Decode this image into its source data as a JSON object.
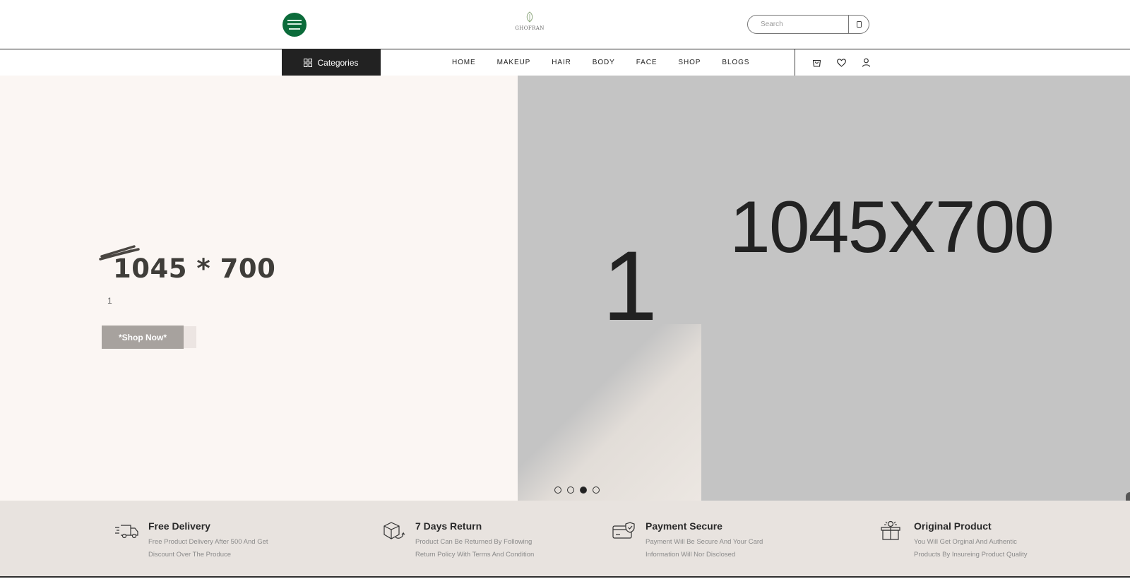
{
  "header": {
    "logo_text": "GHOFRAN",
    "search_placeholder": "Search"
  },
  "nav": {
    "categories_label": "Categories",
    "menu": [
      "HOME",
      "MAKEUP",
      "HAIR",
      "BODY",
      "FACE",
      "SHOP",
      "BLOGS"
    ],
    "icons": [
      "cart-icon",
      "heart-icon",
      "user-icon"
    ]
  },
  "hero": {
    "title": "1045 * 700",
    "subtitle": "1",
    "cta_label": "*Shop Now*",
    "placeholder_text": "1045X700",
    "placeholder_partial": "1(",
    "slides_total": 4,
    "active_slide": 3
  },
  "features": [
    {
      "icon": "delivery-truck-icon",
      "title": "Free Delivery",
      "description": "Free Product Delivery After 500 And Get Discount Over The Produce"
    },
    {
      "icon": "return-box-icon",
      "title": "7 Days Return",
      "description": "Product Can Be Returned By Following Return Policy With Terms And Condition"
    },
    {
      "icon": "secure-card-icon",
      "title": "Payment Secure",
      "description": "Payment Will Be Secure And Your Card Information Will Nor Disclosed"
    },
    {
      "icon": "original-product-icon",
      "title": "Original Product",
      "description": "You Will Get Orginal And Authentic Products By Insureing Product Quality"
    }
  ],
  "colors": {
    "dark": "#222222",
    "hero_left_bg": "#fbf6f3",
    "hero_right_bg": "#c4c4c4",
    "features_bg": "#e8e3df",
    "cta_bg": "#a7a29e",
    "flag_green": "#0b6b3a"
  }
}
